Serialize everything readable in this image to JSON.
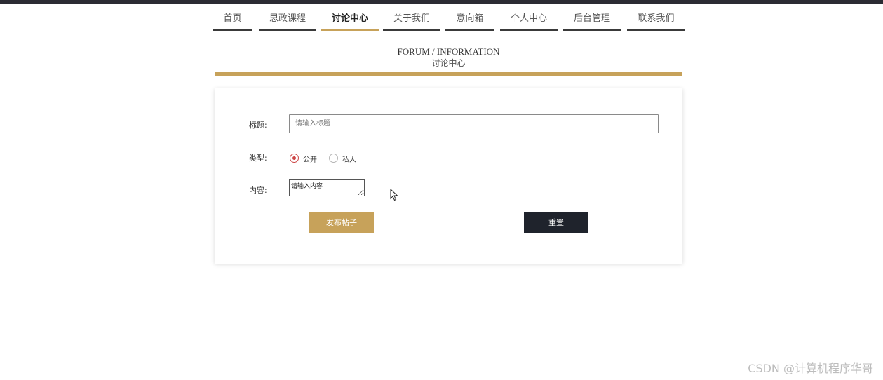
{
  "nav": {
    "items": [
      {
        "label": "首页"
      },
      {
        "label": "思政课程"
      },
      {
        "label": "讨论中心"
      },
      {
        "label": "关于我们"
      },
      {
        "label": "意向箱"
      },
      {
        "label": "个人中心"
      },
      {
        "label": "后台管理"
      },
      {
        "label": "联系我们"
      }
    ],
    "active": "讨论中心"
  },
  "heading": {
    "en": "FORUM / INFORMATION",
    "cn": "讨论中心"
  },
  "form": {
    "title_label": "标题:",
    "title_placeholder": "请输入标题",
    "type_label": "类型:",
    "type_options": [
      "公开",
      "私人"
    ],
    "type_selected": "公开",
    "content_label": "内容:",
    "content_placeholder": "请输入内容",
    "publish_label": "发布帖子",
    "reset_label": "重置"
  },
  "watermark": "CSDN @计算机程序华哥",
  "colors": {
    "accent_gold": "#c7a25a",
    "dark": "#1f232c",
    "radio_selected": "#cc4444"
  }
}
